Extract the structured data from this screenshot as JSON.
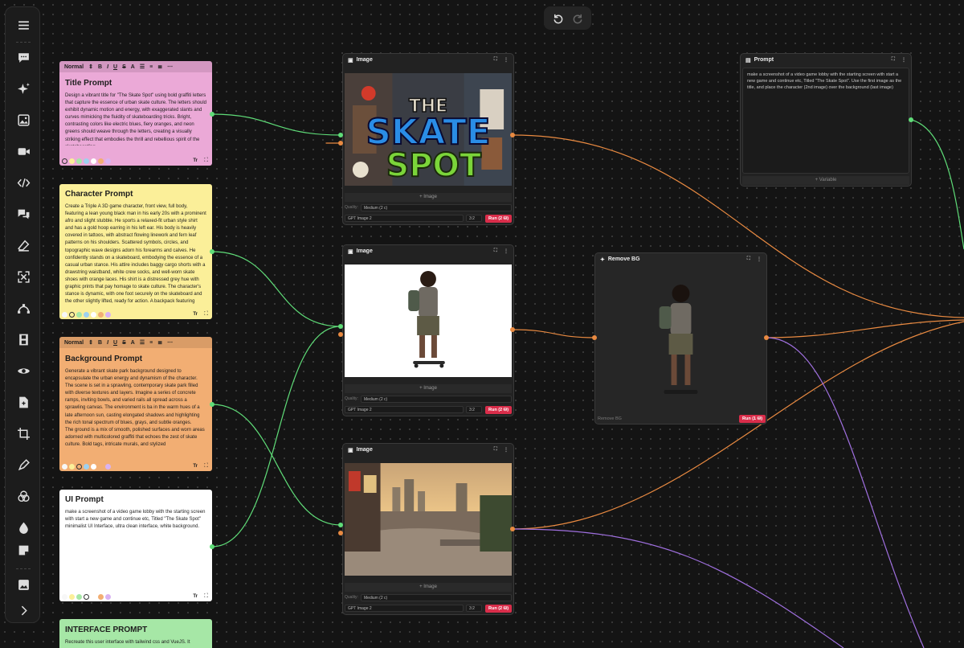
{
  "toolbar": {
    "items": [
      "menu-icon",
      "comment-icon",
      "sparkle-icon",
      "image-icon",
      "video-icon",
      "code-icon",
      "chat-icon",
      "eraser-icon",
      "expand-icon",
      "bezier-icon",
      "film-icon",
      "eye-icon",
      "file-icon",
      "crop-icon",
      "pen-icon",
      "layers-icon",
      "drop-icon",
      "note-icon",
      "gallery-icon",
      "chevron-right-icon"
    ]
  },
  "notes": [
    {
      "title": "Title Prompt",
      "color": "#eba9d7",
      "has_toolbar": true,
      "format_label": "Normal",
      "body": "Design a vibrant title for \"The Skate Spot\" using bold graffiti letters that capture the essence of urban skate culture. The letters should exhibit dynamic motion and energy, with exaggerated slants and curves mimicking the fluidity of skateboarding tricks. Bright, contrasting colors like electric blues, fiery oranges, and neon greens should weave through the letters, creating a visually striking effect that embodies the thrill and rebellious spirit of the skateboarding"
    },
    {
      "title": "Character Prompt",
      "color": "#fbef99",
      "has_toolbar": false,
      "body": "Create a Triple A 3D game character, front view, full body, featuring a lean young black man in his early 20s with a prominent afro and slight stubble. He sports a relaxed-fit urban style shirt and has a gold hoop earring in his left ear. His body is heavily covered in tattoos, with abstract flowing linework and fern leaf patterns on his shoulders. Scattered symbols, circles, and topographic wave designs adorn his forearms and calves. He confidently stands on a skateboard, embodying the essence of a casual urban stance. His attire includes baggy cargo shorts with a drawstring waistband, white crew socks, and well-worn skate shoes with orange laces. His shirt is a distressed grey hue with graphic prints that pay homage to skate culture. The character's stance is dynamic, with one foot securely on the skateboard and the other slightly lifted, ready for action. A backpack featuring"
    },
    {
      "title": "Background Prompt",
      "color": "#f2ae73",
      "has_toolbar": true,
      "format_label": "Normal",
      "body": "Generate a vibrant skate park background designed to encapsulate the urban energy and dynamism of the character. The scene is set in a sprawling, contemporary skate park filled with diverse textures and layers. Imagine a series of concrete ramps, inviting bowls, and varied rails all spread across a sprawling canvas. The environment is ba in the warm hues of a late afternoon sun, casting elongated shadows and highlighting the rich tonal spectrum of blues, grays, and subtle oranges.\nThe ground is a mix of smooth, polished surfaces and worn areas adorned with multicolored graffiti that echoes the zest of skate culture. Bold tags, intricate murals, and stylized"
    },
    {
      "title": "UI Prompt",
      "color": "#ffffff",
      "has_toolbar": false,
      "body": "make a screenshot of a video game lobby with the starting screen with start a new game and continue etc, Titled \"The Skate Spot\"\nminimalist UI Interface, ultra clean interface, white background."
    },
    {
      "title": "INTERFACE PROMPT",
      "color": "#a6e7a6",
      "has_toolbar": false,
      "body": "Recreate this user interface with tailwind css and VueJS. It"
    }
  ],
  "note_footer": {
    "text_icon": "Tr",
    "expand_icon": "⛶"
  },
  "swatches": [
    "#f7f7f7",
    "#fbef99",
    "#a6e7a6",
    "#9ed1f0",
    "#ffffff",
    "#f2ae73",
    "#d9b3f2"
  ],
  "image_nodes": [
    {
      "title": "Image",
      "add_label": "+ Image",
      "quality_label": "Quality:",
      "quality_value": "Medium (2 c)",
      "model": "GPT Image 2",
      "ratio": "3:2",
      "run_label": "Run (2 ⛁)",
      "image_icon": "skate-spot-title-image"
    },
    {
      "title": "Image",
      "add_label": "+ Image",
      "quality_label": "Quality:",
      "quality_value": "Medium (2 c)",
      "model": "GPT Image 2",
      "ratio": "3:2",
      "run_label": "Run (2 ⛁)",
      "image_icon": "skater-character-image"
    },
    {
      "title": "Image",
      "add_label": "+ Image",
      "quality_label": "Quality:",
      "quality_value": "Medium (2 c)",
      "model": "GPT Image 2",
      "ratio": "3:2",
      "run_label": "Run (2 ⛁)",
      "image_icon": "skate-park-image"
    }
  ],
  "remove_bg": {
    "title": "Remove BG",
    "footer_label": "Remove BG",
    "run_label": "Run (1 ⛁)"
  },
  "prompt_node": {
    "title": "Prompt",
    "text": "make a screenshot of a video game lobby with the starting screen with start a new game and continue etc, Titled \"The Skate Spot\". Use the first image as the title, and place the character (2nd image) over the background (last image)",
    "variable_label": "+ Variable"
  },
  "colors": {
    "wire_green": "#5fdc78",
    "wire_orange": "#e98a41",
    "wire_purple": "#a070e0",
    "run_red": "#d92d4a"
  }
}
